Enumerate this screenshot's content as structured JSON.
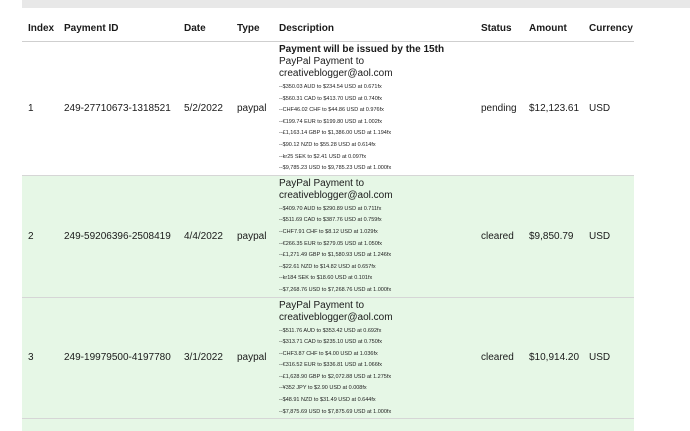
{
  "table": {
    "headers": [
      "Index",
      "Payment ID",
      "Date",
      "Type",
      "Description",
      "Status",
      "Amount",
      "Currency"
    ],
    "rows": [
      {
        "index": "1",
        "payment_id": "249-27710673-1318521",
        "date": "5/2/2022",
        "type": "paypal",
        "note": "Payment will be issued by the 15th",
        "payee": "PayPal Payment to creativeblogger@aol.com",
        "fx": [
          "--$350.03 AUD to $234.54 USD at 0.671fx",
          "--$560.31 CAD to $413.70 USD at 0.740fx",
          "--CHF46.02 CHF to $44.86 USD at 0.976fx",
          "--€199.74 EUR to $199.80 USD at 1.002fx",
          "--£1,163.14 GBP to $1,386.00 USD at 1.194fx",
          "--$90.12 NZD to $55.28 USD at 0.614fx",
          "--kr25 SEK to $2.41 USD at 0.097fx",
          "--$9,785.23 USD to $9,785.23 USD at 1.000fx"
        ],
        "status": "pending",
        "amount": "$12,123.61",
        "currency": "USD"
      },
      {
        "index": "2",
        "payment_id": "249-59206396-2508419",
        "date": "4/4/2022",
        "type": "paypal",
        "note": "",
        "payee": "PayPal Payment to creativeblogger@aol.com",
        "fx": [
          "--$409.70 AUD to $290.89 USD at 0.711fx",
          "--$511.69 CAD to $387.76 USD at 0.759fx",
          "--CHF7.91 CHF to $8.12 USD at 1.029fx",
          "--€266.35 EUR to $279.05 USD at 1.050fx",
          "--£1,271.49 GBP to $1,580.93 USD at 1.246fx",
          "--$22.61 NZD to $14.82 USD at 0.657fx",
          "--kr184 SEK to $18.60 USD at 0.101fx",
          "--$7,268.76 USD to $7,268.76 USD at 1.000fx"
        ],
        "status": "cleared",
        "amount": "$9,850.79",
        "currency": "USD"
      },
      {
        "index": "3",
        "payment_id": "249-19979500-4197780",
        "date": "3/1/2022",
        "type": "paypal",
        "note": "",
        "payee": "PayPal Payment to creativeblogger@aol.com",
        "fx": [
          "--$511.76 AUD to $353.42 USD at 0.692fx",
          "--$313.71 CAD to $235.10 USD at 0.750fx",
          "--CHF3.87 CHF to $4.00 USD at 1.036fx",
          "--€316.52 EUR to $336.81 USD at 1.066fx",
          "--£1,628.90 GBP to $2,072.88 USD at 1.275fx",
          "--¥352 JPY to $2.90 USD at 0.008fx",
          "--$48.91 NZD to $31.49 USD at 0.644fx",
          "--$7,875.69 USD to $7,875.69 USD at 1.000fx"
        ],
        "status": "cleared",
        "amount": "$10,914.20",
        "currency": "USD"
      }
    ]
  }
}
